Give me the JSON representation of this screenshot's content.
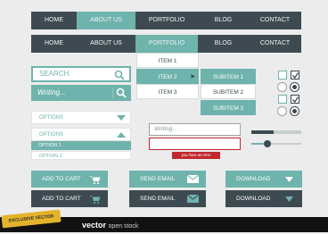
{
  "nav1": [
    {
      "label": "HOME",
      "active": false
    },
    {
      "label": "ABOUT US",
      "active": true
    },
    {
      "label": "PORTFOLIO",
      "active": false
    },
    {
      "label": "BLOG",
      "active": false
    },
    {
      "label": "CONTACT",
      "active": false
    }
  ],
  "nav2": [
    {
      "label": "HOME",
      "active": false
    },
    {
      "label": "ABOUT US",
      "active": false
    },
    {
      "label": "PORTFOLIO",
      "active": true
    },
    {
      "label": "BLOG",
      "active": false
    },
    {
      "label": "CONTACT",
      "active": false
    }
  ],
  "dropdown": {
    "items": [
      "ITEM 1",
      "ITEM 2",
      "ITEM 3"
    ],
    "active_index": 1
  },
  "submenu": {
    "items": [
      "SUBITEM 1",
      "SUBITEM 2",
      "SUBITEM 3"
    ]
  },
  "search1": {
    "placeholder": "SEARCH"
  },
  "search2": {
    "value": "Writing..."
  },
  "select1": {
    "label": "OPTIONS"
  },
  "select2": {
    "label": "OPTIONS",
    "options": [
      "OPTION 1",
      "OPTION 2"
    ],
    "selected_index": 0
  },
  "text_field": {
    "value": "Writing..."
  },
  "error_field": {
    "value": "",
    "error_message": "you have an error"
  },
  "progress": {
    "bar1": 0.45,
    "slider": 0.33
  },
  "checkboxes": [
    false,
    true,
    false,
    true
  ],
  "radios": [
    false,
    true,
    false,
    true
  ],
  "buttons": {
    "cart_label": "ADD TO CART",
    "email_label": "SEND EMAIL",
    "download_label": "DOWNLOAD"
  },
  "badge": {
    "text": "EXCLUSIVE VECTOR"
  },
  "logo": {
    "brand": "vector",
    "suffix": "open stock"
  },
  "colors": {
    "dark": "#3d4a51",
    "teal": "#6fb3ad",
    "error": "#c0282d",
    "bg": "#ececec"
  }
}
